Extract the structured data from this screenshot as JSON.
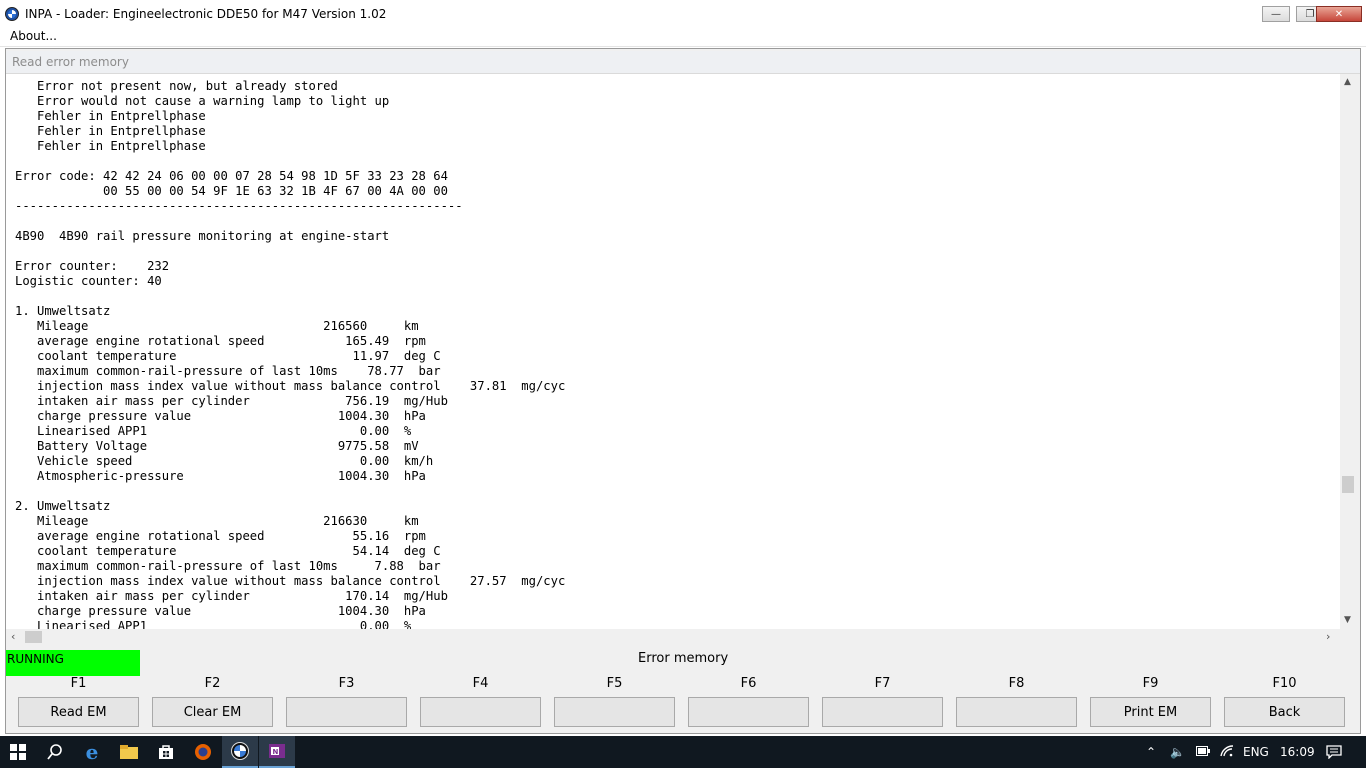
{
  "window": {
    "title": "INPA - Loader:  Engineelectronic DDE50 for M47 Version 1.02"
  },
  "menu": {
    "items": [
      "About..."
    ]
  },
  "panel": {
    "header": "Read error memory"
  },
  "content": {
    "text": "   Error not present now, but already stored\n   Error would not cause a warning lamp to light up\n   Fehler in Entprellphase\n   Fehler in Entprellphase\n   Fehler in Entprellphase\n\nError code: 42 42 24 06 00 00 07 28 54 98 1D 5F 33 23 28 64\n            00 55 00 00 54 9F 1E 63 32 1B 4F 67 00 4A 00 00\n-------------------------------------------------------------\n\n4B90  4B90 rail pressure monitoring at engine-start\n\nError counter:    232\nLogistic counter: 40\n\n1. Umweltsatz\n   Mileage                                216560     km\n   average engine rotational speed           165.49  rpm\n   coolant temperature                        11.97  deg C\n   maximum common-rail-pressure of last 10ms    78.77  bar\n   injection mass index value without mass balance control    37.81  mg/cyc\n   intaken air mass per cylinder             756.19  mg/Hub\n   charge pressure value                    1004.30  hPa\n   Linearised APP1                             0.00  %\n   Battery Voltage                          9775.58  mV\n   Vehicle speed                               0.00  km/h\n   Atmospheric-pressure                     1004.30  hPa\n\n2. Umweltsatz\n   Mileage                                216630     km\n   average engine rotational speed            55.16  rpm\n   coolant temperature                        54.14  deg C\n   maximum common-rail-pressure of last 10ms     7.88  bar\n   injection mass index value without mass balance control    27.57  mg/cyc\n   intaken air mass per cylinder             170.14  mg/Hub\n   charge pressure value                    1004.30  hPa\n   Linearised APP1                             0.00  %"
  },
  "status": {
    "state": "RUNNING",
    "state_color": "#00ff00",
    "label": "Error memory"
  },
  "function_keys": [
    {
      "key": "F1",
      "label": "Read EM"
    },
    {
      "key": "F2",
      "label": "Clear EM"
    },
    {
      "key": "F3",
      "label": ""
    },
    {
      "key": "F4",
      "label": ""
    },
    {
      "key": "F5",
      "label": ""
    },
    {
      "key": "F6",
      "label": ""
    },
    {
      "key": "F7",
      "label": ""
    },
    {
      "key": "F8",
      "label": ""
    },
    {
      "key": "F9",
      "label": "Print EM"
    },
    {
      "key": "F10",
      "label": "Back"
    }
  ],
  "taskbar": {
    "icons": [
      "windows-start-icon",
      "search-icon",
      "edge-icon",
      "file-explorer-icon",
      "store-icon",
      "firefox-icon",
      "bmw-inpa-icon",
      "onenote-icon"
    ],
    "language": "ENG",
    "time": "16:09"
  }
}
